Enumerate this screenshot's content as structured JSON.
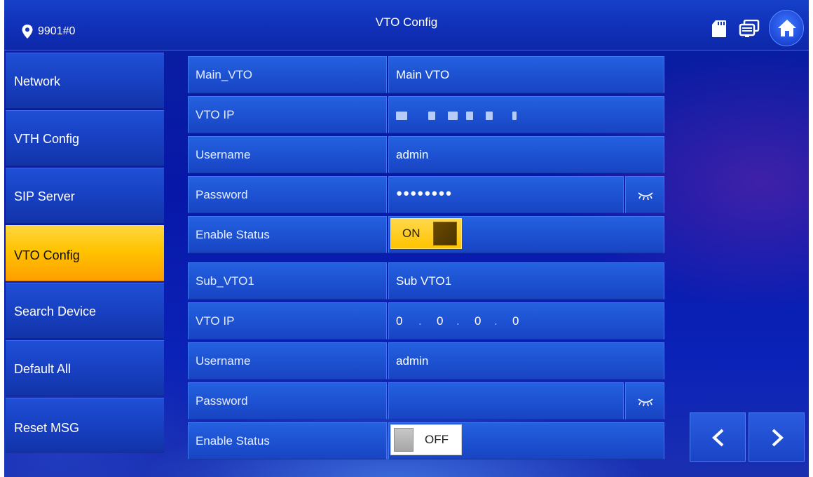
{
  "header": {
    "location": "9901#0",
    "title": "VTO Config",
    "icons": [
      "location-pin-icon",
      "sd-card-icon",
      "devices-icon",
      "home-icon"
    ]
  },
  "sidebar": {
    "items": [
      {
        "label": "Network"
      },
      {
        "label": "VTH Config"
      },
      {
        "label": "SIP Server"
      },
      {
        "label": "VTO Config",
        "active": true
      },
      {
        "label": "Search Device"
      },
      {
        "label": "Default All"
      },
      {
        "label": "Reset MSG"
      }
    ]
  },
  "main_vto": {
    "name_label": "Main_VTO",
    "name_value": "Main VTO",
    "ip_label": "VTO IP",
    "ip_value_obscured": true,
    "username_label": "Username",
    "username_value": "admin",
    "password_label": "Password",
    "password_value": "●●●●●●●●",
    "enable_label": "Enable Status",
    "enable_state": "ON"
  },
  "sub_vto1": {
    "name_label": "Sub_VTO1",
    "name_value": "Sub VTO1",
    "ip_label": "VTO IP",
    "ip_octets": [
      "0",
      "0",
      "0",
      "0"
    ],
    "ip_separator": ".",
    "username_label": "Username",
    "username_value": "admin",
    "password_label": "Password",
    "password_value": "",
    "enable_label": "Enable Status",
    "enable_state": "OFF"
  },
  "colors": {
    "accent_active": "#ffc400",
    "panel_blue": "#1d52d2",
    "background": "#0a1fa0"
  }
}
